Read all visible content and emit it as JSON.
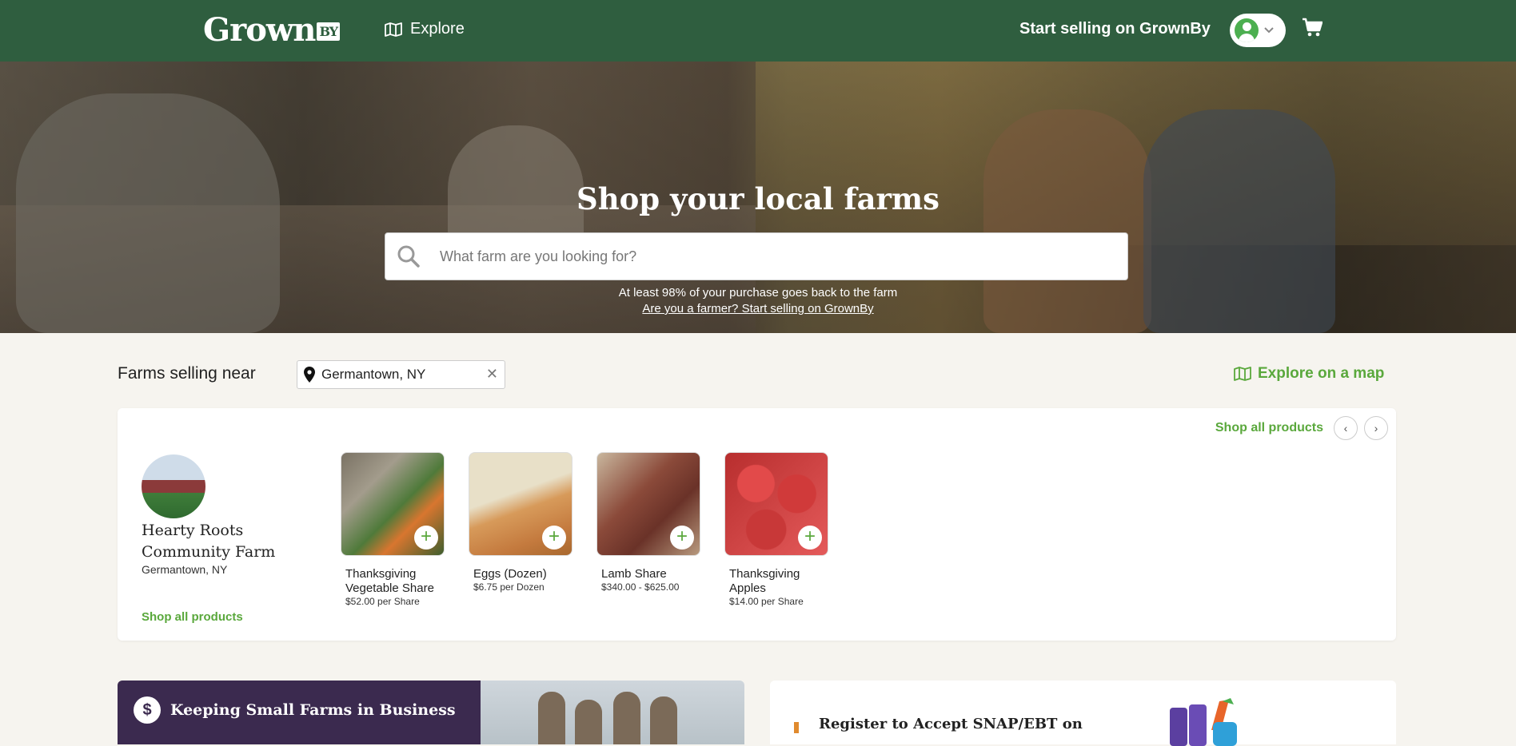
{
  "header": {
    "logo_text": "Grown",
    "logo_suffix": "BY",
    "explore_label": "Explore",
    "sell_label": "Start selling on GrownBy"
  },
  "hero": {
    "title": "Shop your local farms",
    "search_placeholder": "What farm are you looking for?",
    "note": "At least 98% of your purchase goes back to the farm",
    "farmer_link": "Are you a farmer? Start selling on GrownBy"
  },
  "near": {
    "title": "Farms selling near",
    "location": "Germantown, NY",
    "map_link": "Explore on a map"
  },
  "farm": {
    "shop_all_top": "Shop all products",
    "name": "Hearty Roots Community Farm",
    "location": "Germantown, NY",
    "shop_all_bottom": "Shop all products",
    "products": [
      {
        "name": "Thanksgiving Vegetable Share",
        "price": "$52.00 per Share"
      },
      {
        "name": "Eggs (Dozen)",
        "price": "$6.75 per Dozen"
      },
      {
        "name": "Lamb Share",
        "price": "$340.00 - $625.00"
      },
      {
        "name": "Thanksgiving Apples",
        "price": "$14.00 per Share"
      }
    ]
  },
  "promo": {
    "title": "Keeping Small Farms in Business",
    "icon_text": "$"
  },
  "snap": {
    "title": "Register to Accept SNAP/EBT on"
  },
  "colors": {
    "header_bg": "#2f5e3f",
    "accent_green": "#5aa83c",
    "promo_purple": "#3b2a4f"
  }
}
